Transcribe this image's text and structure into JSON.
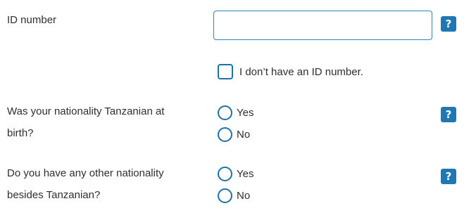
{
  "id_field": {
    "label": "ID number",
    "value": "",
    "placeholder": "",
    "help_icon": "?"
  },
  "no_id_checkbox": {
    "label": "I don’t have an ID number.",
    "checked": false
  },
  "nationality_at_birth": {
    "label_line1": "Was your nationality Tanzanian at",
    "label_line2": "birth?",
    "options": [
      {
        "label": "Yes",
        "selected": false
      },
      {
        "label": "No",
        "selected": false
      }
    ],
    "help_icon": "?"
  },
  "other_nationality": {
    "label_line1": "Do you have any other nationality",
    "label_line2": "besides Tanzanian?",
    "options": [
      {
        "label": "Yes",
        "selected": false
      },
      {
        "label": "No",
        "selected": false
      }
    ],
    "help_icon": "?"
  },
  "colors": {
    "accent": "#1f78b4",
    "input_border": "#2e86b8",
    "text": "#2f2f2f"
  },
  "icons": {
    "help": "help-icon"
  }
}
